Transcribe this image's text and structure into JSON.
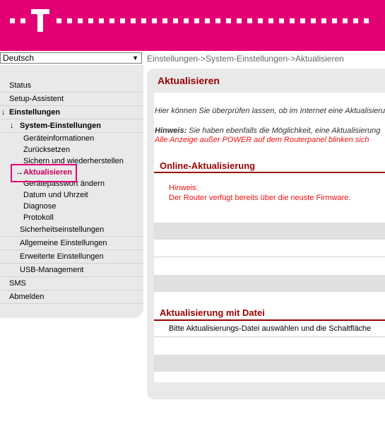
{
  "language": {
    "selected": "Deutsch"
  },
  "breadcrumb": "Einstellungen->System-Einstellungen->Aktualisieren",
  "sidebar": {
    "status": "Status",
    "setup": "Setup-Assistent",
    "einstellungen": "Einstellungen",
    "system": "System-Einstellungen",
    "sub_items": [
      "Geräteinformationen",
      "Zurücksetzen",
      "Sichern und wiederherstellen",
      "Aktualisieren",
      "Gerätepasswort ändern",
      "Datum und Uhrzeit",
      "Diagnose",
      "Protokoll"
    ],
    "security": "Sicherheitseinstellungen",
    "general": "Allgemeine Einstellungen",
    "advanced": "Erweiterte Einstellungen",
    "usb": "USB-Management",
    "sms": "SMS",
    "logout": "Abmelden"
  },
  "main": {
    "title": "Aktualisieren",
    "intro": "Hier können Sie überprüfen lassen, ob im Internet eine Aktualisierung",
    "hint_label": "Hinweis:",
    "hint_text": " Sie haben ebenfalls die Möglichkeit, eine Aktualisierung",
    "hint_red": "Alle Anzeige außer POWER auf dem Routerpanel blinken sich",
    "online_title": "Online-Aktualisierung",
    "online_hint_label": "Hinweis:",
    "online_hint_text": "Der Router verfügt bereits über die neuste Firmware.",
    "file_title": "Aktualisierung mit Datei",
    "file_text": "Bitte Aktualisierungs-Datei auswählen und die Schaltfläche"
  },
  "colors": {
    "brand": "#e20074",
    "section": "#990000",
    "alert": "#ee1111"
  }
}
